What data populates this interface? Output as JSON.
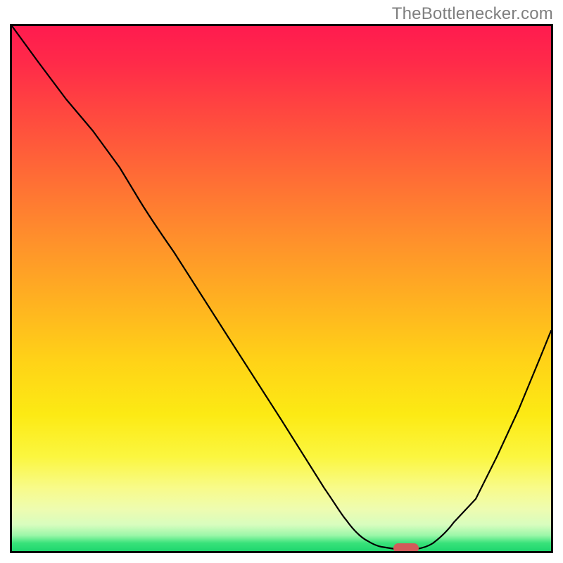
{
  "watermark": "TheBottlenecker.com",
  "colors": {
    "frame": "#000000",
    "curve": "#000000",
    "marker": "#d25a5a",
    "gradient_top": "#ff1b4f",
    "gradient_mid": "#ffd317",
    "gradient_bottom": "#1fd66e",
    "watermark_text": "#7f7f7f"
  },
  "chart_data": {
    "type": "line",
    "title": "",
    "xlabel": "",
    "ylabel": "",
    "xlim": [
      0,
      100
    ],
    "ylim": [
      0,
      100
    ],
    "x": [
      0,
      5,
      10,
      15,
      20,
      23,
      30,
      40,
      50,
      58,
      62,
      66,
      68,
      71,
      75,
      78,
      82,
      86,
      90,
      94,
      98,
      100
    ],
    "values": [
      100,
      93,
      86,
      80,
      73,
      68,
      57,
      41,
      25,
      12,
      6,
      2,
      1,
      0,
      0,
      1,
      4,
      10,
      18,
      27,
      37,
      42
    ],
    "marker": {
      "x": 73,
      "y": 0.5,
      "shape": "rounded-rect"
    },
    "notes": "V-shaped bottleneck curve over a red-to-green vertical gradient; no axis ticks or labels shown in image."
  }
}
